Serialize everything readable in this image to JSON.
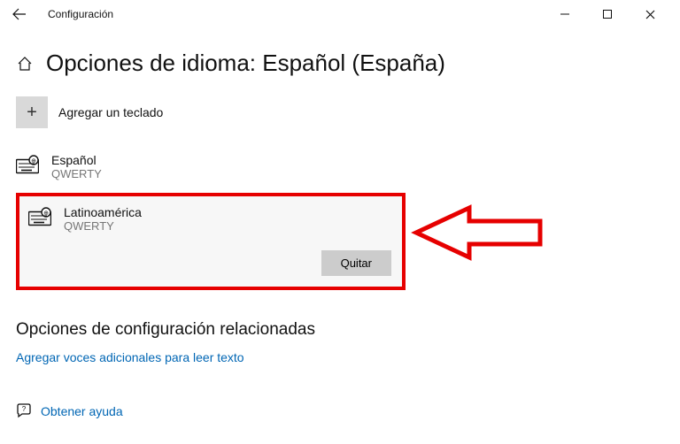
{
  "titlebar": {
    "title": "Configuración"
  },
  "header": {
    "title": "Opciones de idioma: Español (España)"
  },
  "add": {
    "label": "Agregar un teclado"
  },
  "keyboards": [
    {
      "name": "Español",
      "layout": "QWERTY"
    },
    {
      "name": "Latinoamérica",
      "layout": "QWERTY"
    }
  ],
  "buttons": {
    "remove": "Quitar"
  },
  "related": {
    "heading": "Opciones de configuración relacionadas",
    "link": "Agregar voces adicionales para leer texto"
  },
  "help": {
    "label": "Obtener ayuda"
  }
}
